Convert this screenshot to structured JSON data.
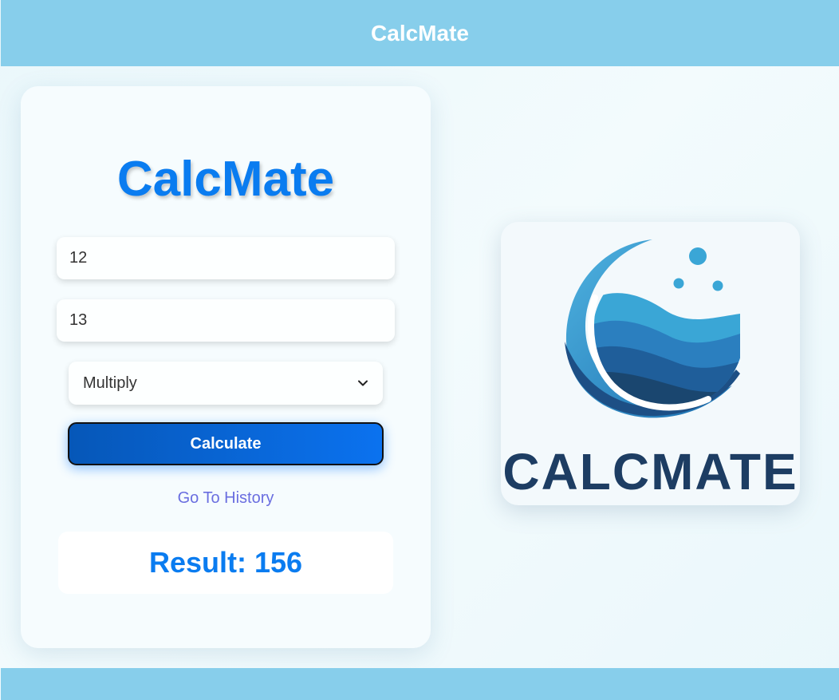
{
  "header": {
    "title": "CalcMate"
  },
  "calculator": {
    "title": "CalcMate",
    "first_number": "12",
    "second_number": "13",
    "operation": "Multiply",
    "calculate_label": "Calculate",
    "history_link": "Go To History",
    "result": "Result: 156"
  },
  "logo": {
    "icon": "calcmate-logo-icon",
    "wordmark": "CALCMATE"
  },
  "colors": {
    "header_bar": "#87ceeb",
    "accent_blue": "#0a7cf0",
    "link_purple": "#6a6ee0",
    "logo_dark": "#1d3d63"
  }
}
